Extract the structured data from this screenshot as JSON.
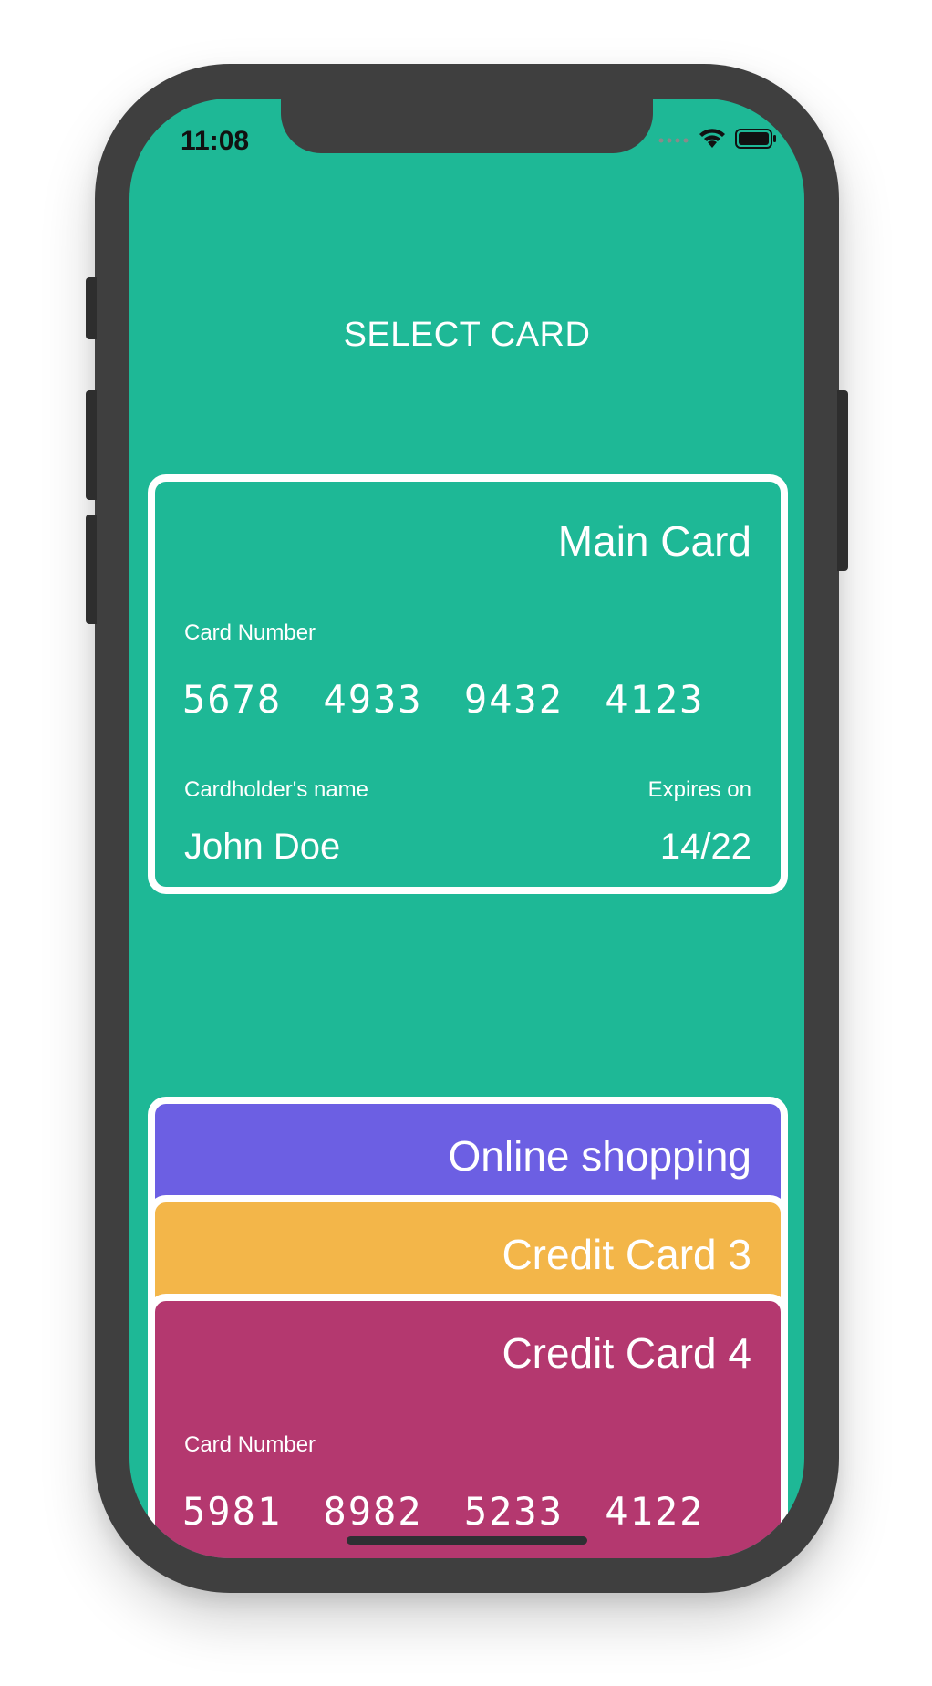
{
  "status_bar": {
    "time": "11:08"
  },
  "header": {
    "title": "SELECT CARD"
  },
  "colors": {
    "screen_bg": "#1eb896",
    "card1": "#1eb896",
    "card2": "#6c5fe3",
    "card3": "#f3b649",
    "card4": "#b4386f"
  },
  "cards": [
    {
      "name": "Main Card",
      "number_label": "Card Number",
      "number": "5678 4933 9432 4123",
      "holder_label": "Cardholder's name",
      "holder": "John Doe",
      "expiry_label": "Expires on",
      "expiry": "14/22"
    },
    {
      "name": "Online shopping"
    },
    {
      "name": "Credit Card 3"
    },
    {
      "name": "Credit Card 4",
      "number_label": "Card Number",
      "number": "5981 8982 5233 4122"
    }
  ]
}
